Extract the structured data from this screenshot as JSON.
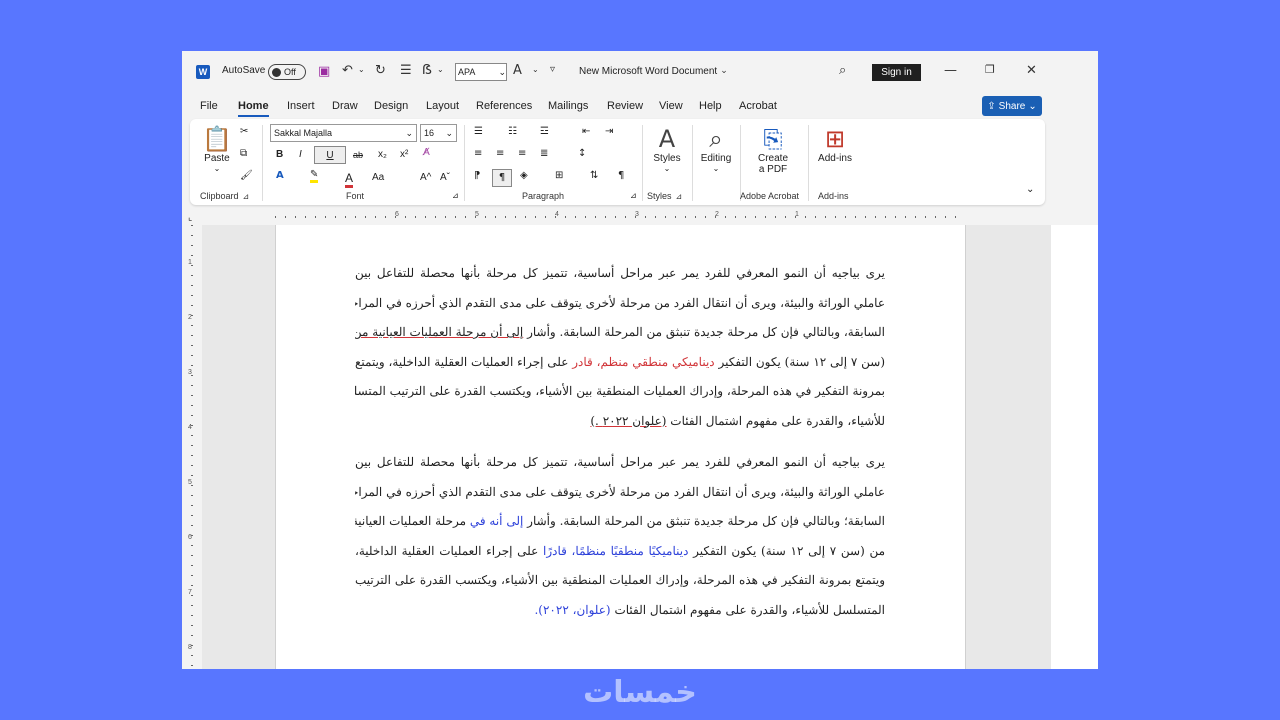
{
  "titlebar": {
    "app_icon": "W",
    "autosave_label": "AutoSave",
    "autosave_state": "Off",
    "style_select": "APA",
    "document_title": "New Microsoft Word Document",
    "signin_label": "Sign in",
    "icons": [
      "save-icon",
      "undo-icon",
      "redo-icon",
      "bullets-icon",
      "format-painter-icon",
      "font-color-icon",
      "customize-icon",
      "search-icon",
      "minimize-icon",
      "restore-icon",
      "close-icon"
    ]
  },
  "menu": {
    "items": [
      "File",
      "Home",
      "Insert",
      "Draw",
      "Design",
      "Layout",
      "References",
      "Mailings",
      "Review",
      "View",
      "Help",
      "Acrobat"
    ],
    "active": "Home",
    "share_label": "Share"
  },
  "ribbon": {
    "clipboard": {
      "paste_label": "Paste",
      "group_label": "Clipboard"
    },
    "font": {
      "font_name": "Sakkal Majalla",
      "font_size": "16",
      "group_label": "Font",
      "buttons": [
        "B",
        "I",
        "U",
        "ab",
        "x₂",
        "x²",
        "A",
        "A",
        "Aa",
        "A^",
        "Aˇ"
      ]
    },
    "paragraph": {
      "group_label": "Paragraph"
    },
    "styles": {
      "label": "Styles",
      "group_label": "Styles"
    },
    "editing": {
      "label": "Editing"
    },
    "acrobat": {
      "label_line1": "Create",
      "label_line2": "a PDF",
      "group_label": "Adobe Acrobat"
    },
    "addins": {
      "label": "Add-ins",
      "group_label": "Add-ins"
    }
  },
  "ruler": {
    "numbers": [
      "6",
      "5",
      "4",
      "3",
      "2",
      "1"
    ],
    "vertical_numbers": [
      "1",
      "2",
      "3",
      "4",
      "5",
      "6",
      "7",
      "8",
      "9"
    ]
  },
  "document": {
    "paragraph1": [
      [
        {
          "t": "يرى بياجيه أن النمو المعرفي للفرد يمر عبر مراحل أساسية، تتميز كل مرحلة بأنها محصلة للتفاعل بين"
        }
      ],
      [
        {
          "t": "عاملي الوراثة والبيئة، ويرى أن انتقال الفرد من مرحلة لأخرى يتوقف على مدى التقدم الذي أحرزه في المراحل"
        }
      ],
      [
        {
          "t": "السابقة، وبالتالي فإن كل مرحلة جديدة تنبثق من المرحلة السابقة. وأشار "
        },
        {
          "t": "إلى أن مرحلة العمليات العيانية من",
          "c": "uline"
        }
      ],
      [
        {
          "t": "(سن ٧ إلى ١٢ سنة) يكون التفكير "
        },
        {
          "t": "ديناميكي منطقي منظم، قادر",
          "c": "red"
        },
        {
          "t": " على إجراء العمليات العقلية الداخلية، ويتمتع"
        }
      ],
      [
        {
          "t": "بمرونة التفكير في هذه المرحلة، وإدراك العمليات المنطقية بين الأشياء، ويكتسب القدرة على الترتيب المتسلسل"
        }
      ],
      [
        {
          "t": "للأشياء، والقدرة على مفهوم اشتمال الفئات "
        },
        {
          "t": "(علوان ٢٠٢٢ .)",
          "c": "uline"
        }
      ]
    ],
    "paragraph2": [
      [
        {
          "t": "يرى بياجيه أن النمو المعرفي للفرد يمر عبر مراحل أساسية، تتميز كل مرحلة بأنها محصلة للتفاعل بين"
        }
      ],
      [
        {
          "t": "عاملي الوراثة والبيئة، ويرى أن انتقال الفرد من مرحلة لأخرى يتوقف على مدى التقدم الذي أحرزه في المراحل"
        }
      ],
      [
        {
          "t": "السابقة؛ وبالتالي فإن كل مرحلة جديدة تنبثق من المرحلة السابقة. وأشار "
        },
        {
          "t": "إلى أنه في",
          "c": "blue"
        },
        {
          "t": " مرحلة العمليات العيانية"
        }
      ],
      [
        {
          "t": "من (سن ٧ إلى ١٢ سنة) يكون التفكير "
        },
        {
          "t": "ديناميكيًا منطقيًا منظمًا، قادرًا",
          "c": "blue"
        },
        {
          "t": " على إجراء العمليات العقلية الداخلية،"
        }
      ],
      [
        {
          "t": "ويتمتع بمرونة التفكير في هذه المرحلة، وإدراك العمليات المنطقية بين الأشياء، ويكتسب القدرة على الترتيب"
        }
      ],
      [
        {
          "t": "المتسلسل للأشياء، والقدرة على مفهوم اشتمال الفئات "
        },
        {
          "t": "(علوان، ٢٠٢٢).",
          "c": "blue"
        }
      ]
    ]
  },
  "watermark": "خمسات"
}
